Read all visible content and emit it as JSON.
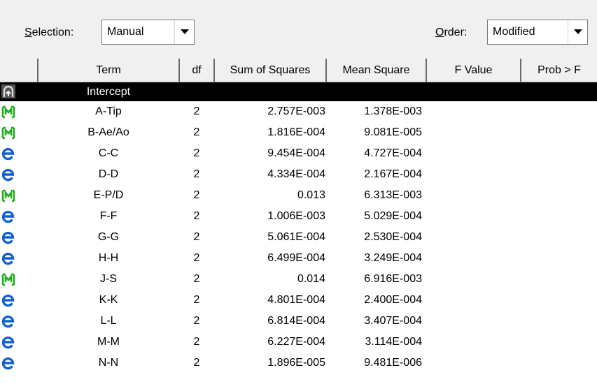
{
  "toolbar": {
    "selection_label": "Selection:",
    "selection_mnemonic": "S",
    "selection_rest": "election:",
    "selection_value": "Manual",
    "order_label": "Order:",
    "order_mnemonic": "O",
    "order_rest": "rder:",
    "order_value": "Modified"
  },
  "table": {
    "columns": [
      "",
      "Term",
      "df",
      "Sum of Squares",
      "Mean Square",
      "F Value",
      "Prob > F"
    ],
    "rows": [
      {
        "icon": "intercept-icon",
        "term": "Intercept",
        "df": "",
        "ss": "",
        "ms": "",
        "selected": true
      },
      {
        "icon": "model-term-icon",
        "term": "A-Tip",
        "df": "2",
        "ss": "2.757E-003",
        "ms": "1.378E-003"
      },
      {
        "icon": "model-term-icon",
        "term": "B-Ae/Ao",
        "df": "2",
        "ss": "1.816E-004",
        "ms": "9.081E-005"
      },
      {
        "icon": "error-term-icon",
        "term": "C-C",
        "df": "2",
        "ss": "9.454E-004",
        "ms": "4.727E-004"
      },
      {
        "icon": "error-term-icon",
        "term": "D-D",
        "df": "2",
        "ss": "4.334E-004",
        "ms": "2.167E-004"
      },
      {
        "icon": "model-term-icon",
        "term": "E-P/D",
        "df": "2",
        "ss": "0.013",
        "ms": "6.313E-003"
      },
      {
        "icon": "error-term-icon",
        "term": "F-F",
        "df": "2",
        "ss": "1.006E-003",
        "ms": "5.029E-004"
      },
      {
        "icon": "error-term-icon",
        "term": "G-G",
        "df": "2",
        "ss": "5.061E-004",
        "ms": "2.530E-004"
      },
      {
        "icon": "error-term-icon",
        "term": "H-H",
        "df": "2",
        "ss": "6.499E-004",
        "ms": "3.249E-004"
      },
      {
        "icon": "model-term-icon",
        "term": "J-S",
        "df": "2",
        "ss": "0.014",
        "ms": "6.916E-003"
      },
      {
        "icon": "error-term-icon",
        "term": "K-K",
        "df": "2",
        "ss": "4.801E-004",
        "ms": "2.400E-004"
      },
      {
        "icon": "error-term-icon",
        "term": "L-L",
        "df": "2",
        "ss": "6.814E-004",
        "ms": "3.407E-004"
      },
      {
        "icon": "error-term-icon",
        "term": "M-M",
        "df": "2",
        "ss": "6.227E-004",
        "ms": "3.114E-004"
      },
      {
        "icon": "error-term-icon",
        "term": "N-N",
        "df": "2",
        "ss": "1.896E-005",
        "ms": "9.481E-006"
      }
    ]
  },
  "colors": {
    "model_icon": "#1faa1f",
    "error_icon": "#1060d0",
    "selected_row_bg": "#000000"
  }
}
